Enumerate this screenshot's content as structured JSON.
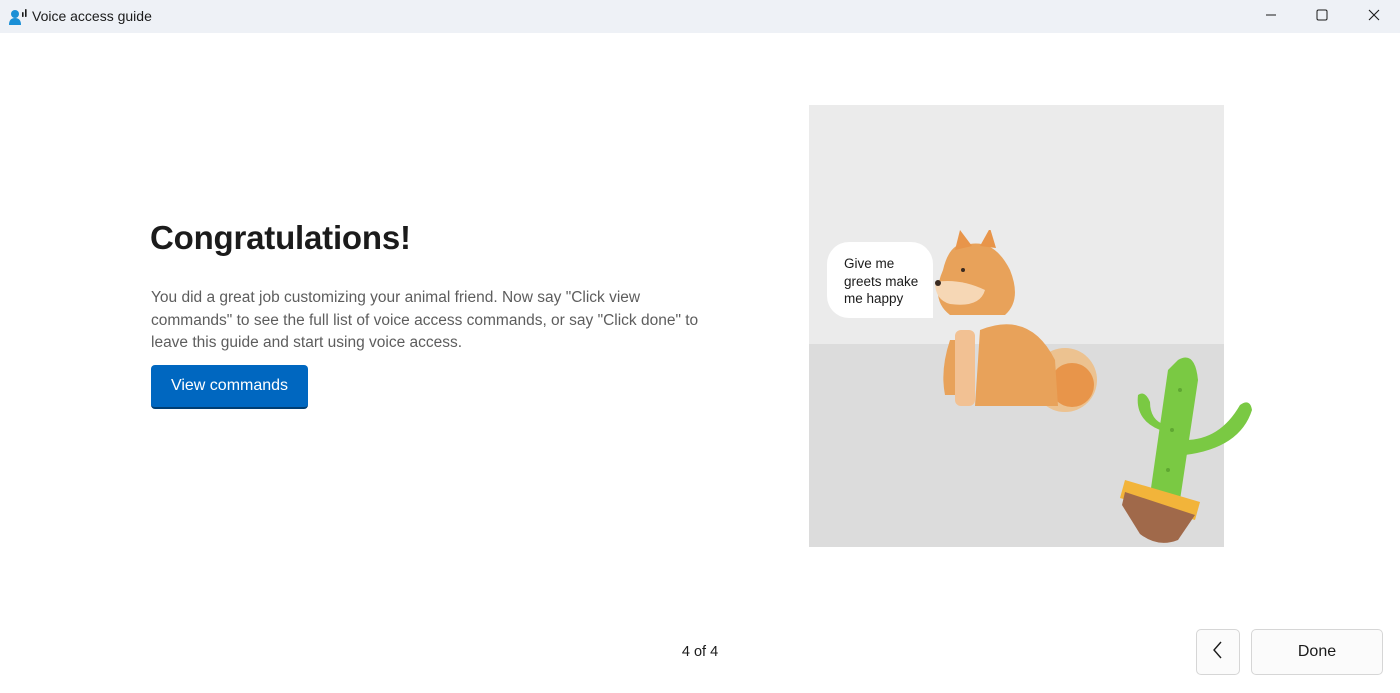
{
  "window": {
    "title": "Voice access guide",
    "icon": "voice-access-icon",
    "controls": {
      "minimize": "minimize-icon",
      "maximize": "maximize-icon",
      "close": "close-icon"
    }
  },
  "content": {
    "heading": "Congratulations!",
    "description": "You did a great job customizing your animal friend. Now say \"Click view commands\" to see the full list of voice access commands, or say \"Click done\" to leave this guide and start using voice access.",
    "view_commands_label": "View commands"
  },
  "illustration": {
    "speech_bubble": "Give me greets make me happy"
  },
  "footer": {
    "page_indicator": "4 of 4",
    "back_icon": "chevron-left-icon",
    "done_label": "Done"
  },
  "colors": {
    "accent": "#0067c0",
    "titlebar": "#eef1f6",
    "dog": "#e8a25a",
    "cactus": "#7ac943",
    "pot": "#a0694a"
  }
}
